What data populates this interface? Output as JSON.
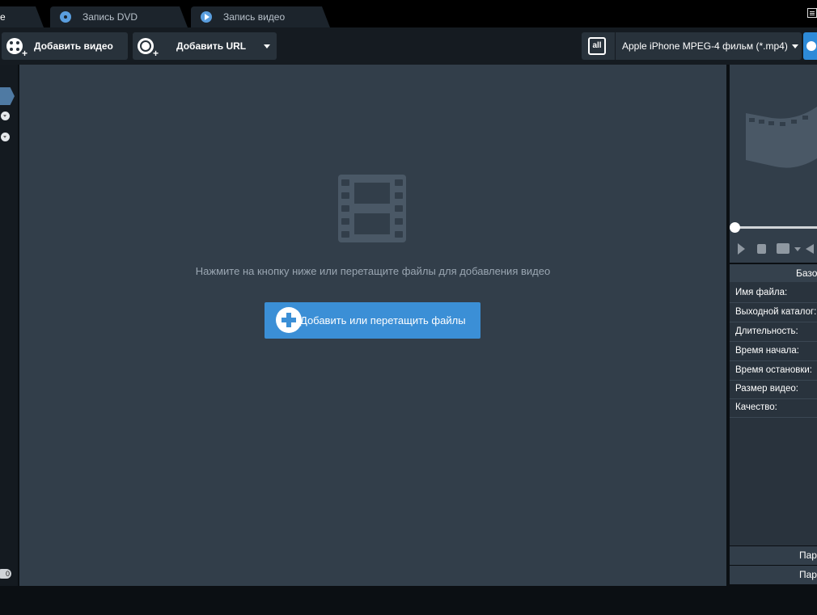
{
  "tabs": [
    {
      "label": "е"
    },
    {
      "label": "Запись DVD",
      "icon": "disc-icon"
    },
    {
      "label": "Запись видео",
      "icon": "play-icon"
    }
  ],
  "toolbar": {
    "add_video_label": "Добавить видео",
    "add_url_label": "Добавить URL",
    "profile_icon_text": "all",
    "profile_label": "Apple iPhone MPEG-4 фильм (*.mp4)"
  },
  "left_strip": {
    "count": "0"
  },
  "dropzone": {
    "hint": "Нажмите на кнопку ниже или перетащите файлы для добавления видео",
    "add_button_label": "Добавить или перетащить файлы"
  },
  "properties": {
    "header": "Базо",
    "rows": [
      {
        "label": "Имя файла:"
      },
      {
        "label": "Выходной каталог:"
      },
      {
        "label": "Длительность:"
      },
      {
        "label": "Время начала:"
      },
      {
        "label": "Время остановки:"
      },
      {
        "label": "Размер видео:"
      },
      {
        "label": "Качество:"
      }
    ],
    "footer_1": "Пар",
    "footer_2": "Пар"
  },
  "colors": {
    "accent": "#3b8fd6",
    "panel": "#323e4a",
    "toolbar": "#151b21"
  }
}
